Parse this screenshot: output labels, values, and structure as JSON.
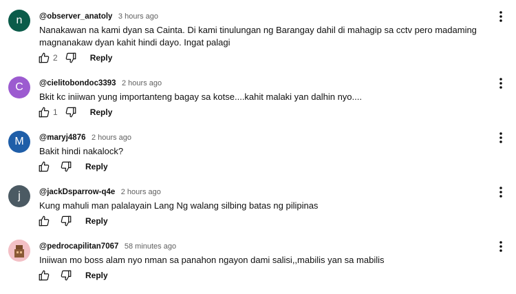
{
  "comments": [
    {
      "author": "@observer_anatoly",
      "time": "3 hours ago",
      "avatar_letter": "n",
      "avatar_color": "#0b5c4a",
      "text": "Nanakawan na kami dyan sa Cainta. Di kami tinulungan ng Barangay dahil di mahagip sa cctv pero madaming magnanakaw dyan kahit hindi dayo. Ingat palagi",
      "likes": "2",
      "reply_label": "Reply"
    },
    {
      "author": "@cielitobondoc3393",
      "time": "2 hours ago",
      "avatar_letter": "C",
      "avatar_color": "#9c5bd0",
      "text": "Bkit kc iniiwan yung importanteng bagay sa kotse....kahit malaki yan dalhin nyo....",
      "likes": "1",
      "reply_label": "Reply"
    },
    {
      "author": "@maryj4876",
      "time": "2 hours ago",
      "avatar_letter": "M",
      "avatar_color": "#1f5ea8",
      "text": "Bakit hindi nakalock?",
      "likes": "",
      "reply_label": "Reply"
    },
    {
      "author": "@jackDsparrow-q4e",
      "time": "2 hours ago",
      "avatar_letter": "j",
      "avatar_color": "#4b5a63",
      "text": "Kung mahuli man palalayain Lang Ng walang silbing batas ng pilipinas",
      "likes": "",
      "reply_label": "Reply"
    },
    {
      "author": "@pedrocapilitan7067",
      "time": "58 minutes ago",
      "avatar_letter": "",
      "avatar_color": "#f3c0c6",
      "text": "Iniiwan mo boss alam nyo nman sa panahon ngayon dami salisi,,mabilis yan sa mabilis",
      "likes": "",
      "reply_label": "Reply"
    }
  ],
  "icons": {
    "like": "thumb-up-icon",
    "dislike": "thumb-down-icon",
    "more": "more-vertical-icon"
  }
}
